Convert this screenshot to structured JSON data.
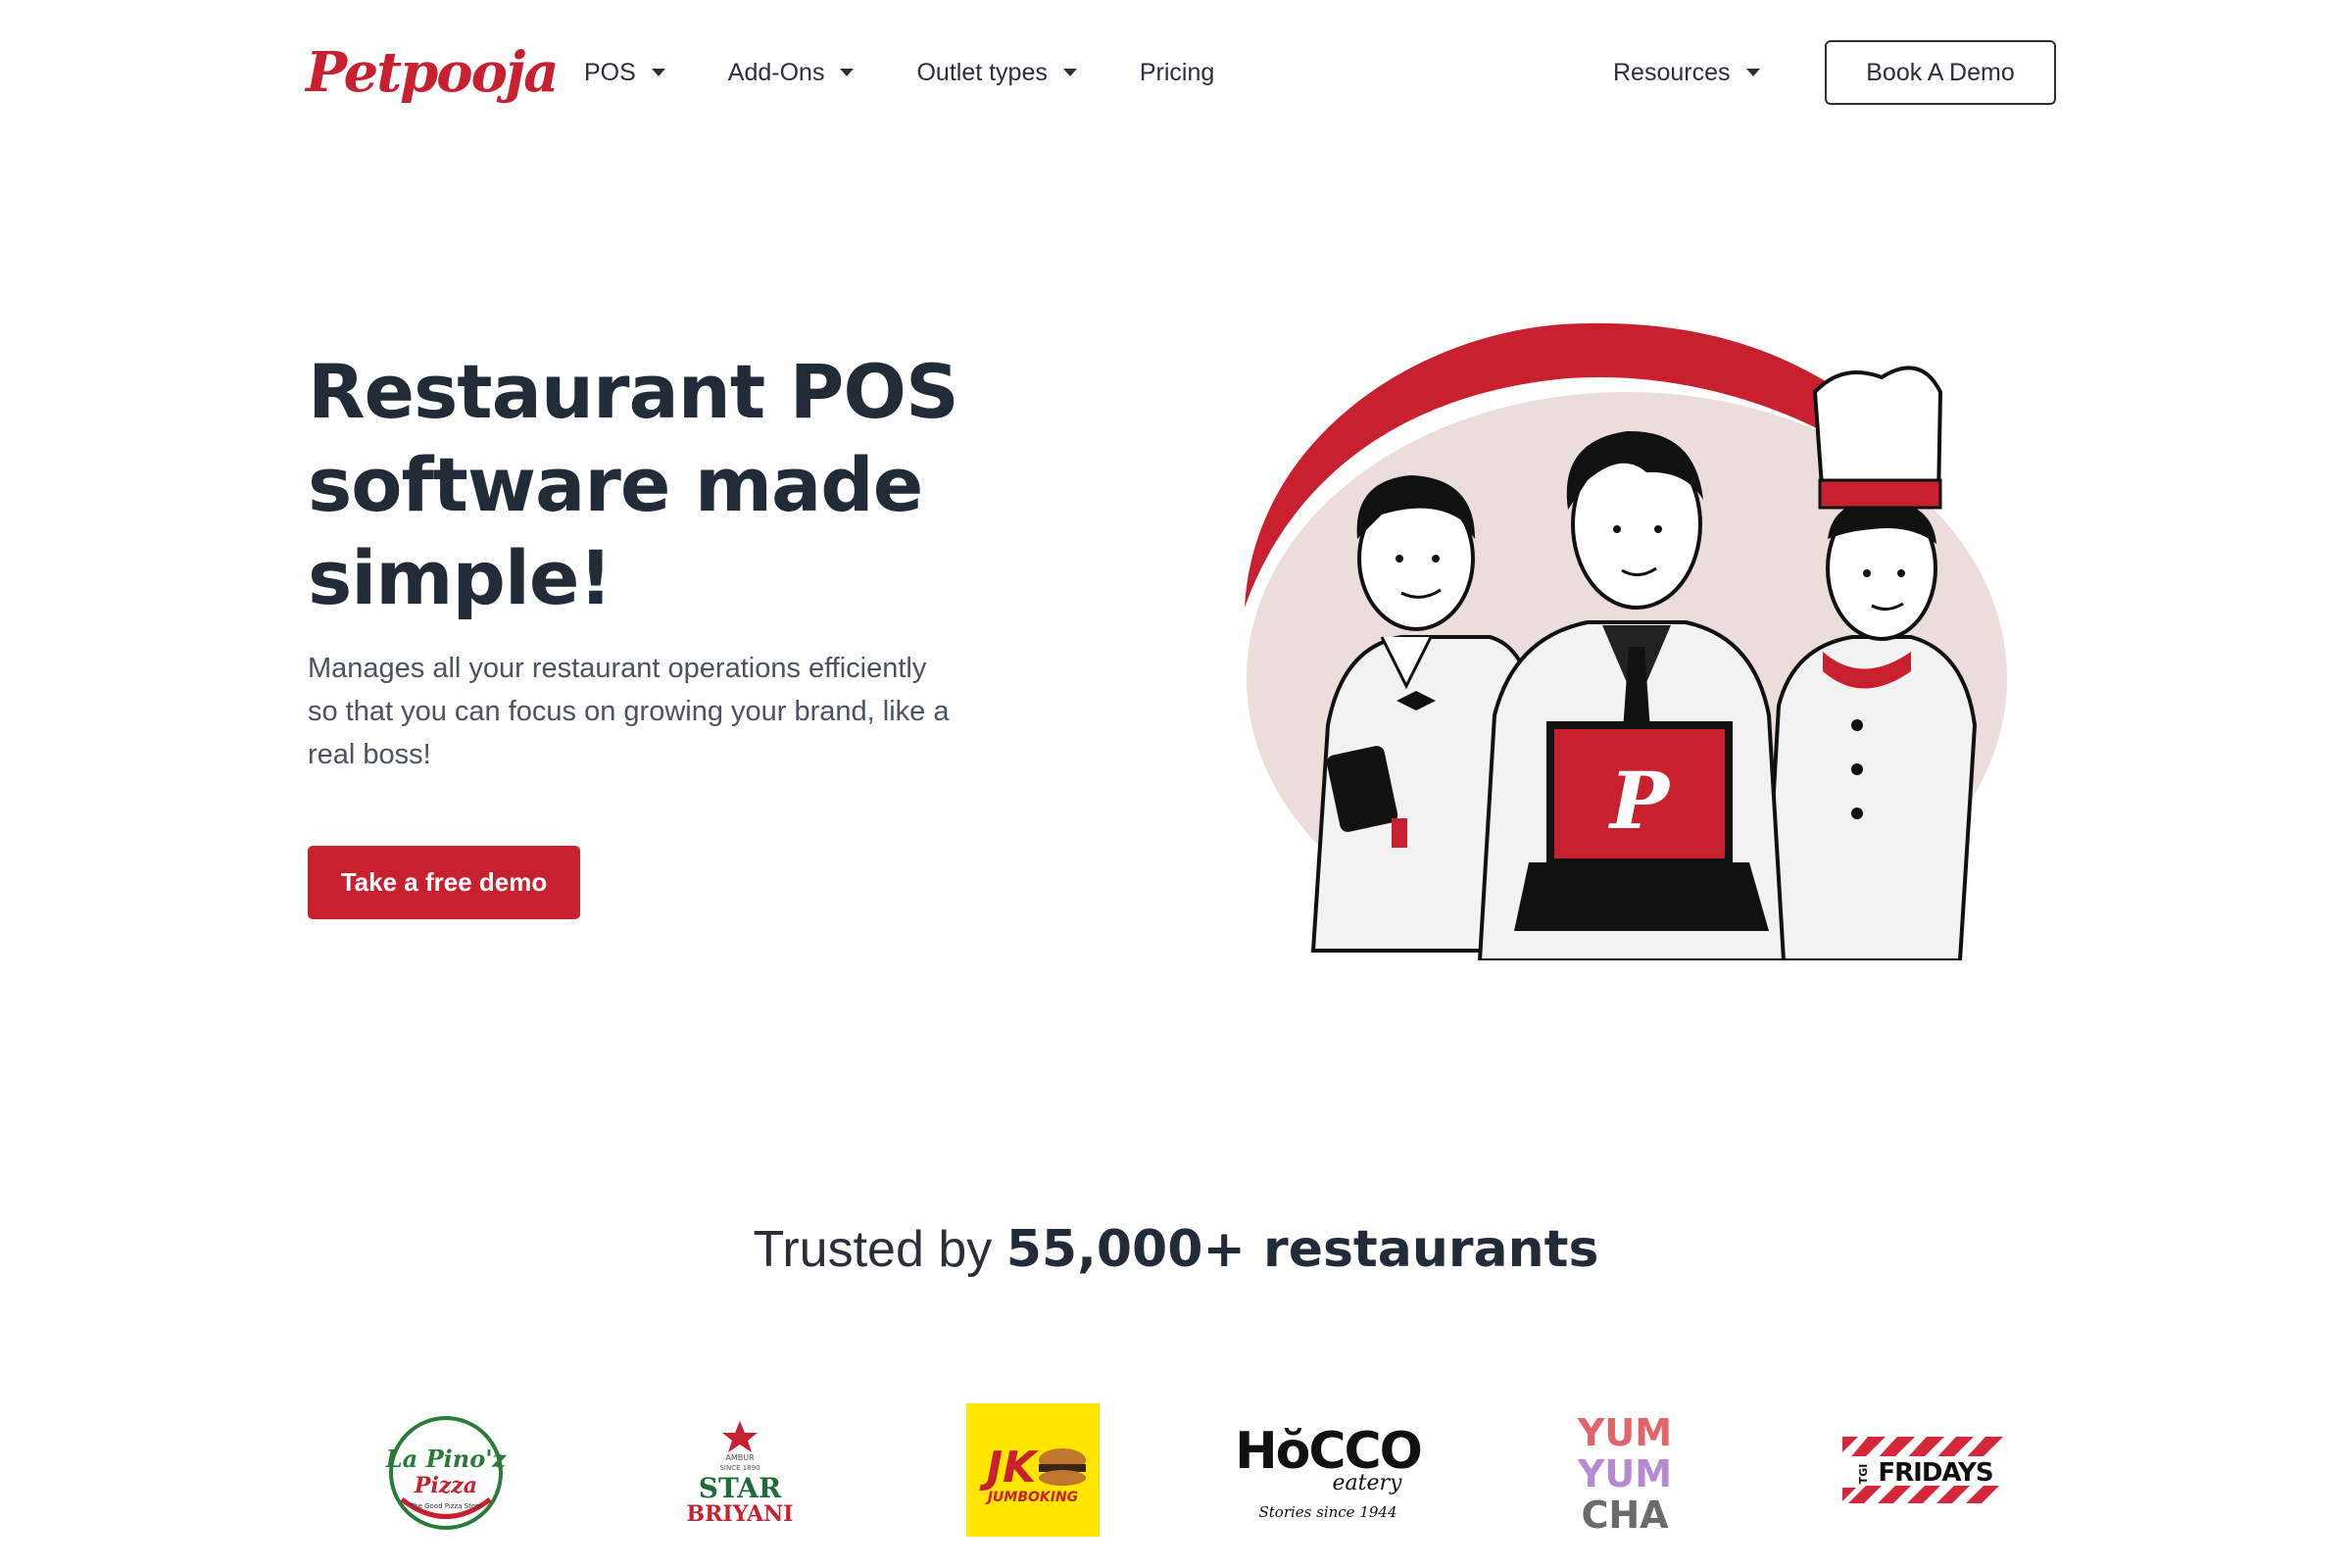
{
  "header": {
    "logo_text": "Petpooja",
    "nav": [
      {
        "label": "POS",
        "has_dropdown": true
      },
      {
        "label": "Add-Ons",
        "has_dropdown": true
      },
      {
        "label": "Outlet types",
        "has_dropdown": true
      },
      {
        "label": "Pricing",
        "has_dropdown": false
      }
    ],
    "resources_label": "Resources",
    "book_demo_label": "Book A Demo"
  },
  "hero": {
    "title": "Restaurant POS software made simple!",
    "subtitle": "Manages all your restaurant operations efficiently so that you can focus on growing your brand, like a real boss!",
    "cta_label": "Take a free demo",
    "laptop_letter": "P"
  },
  "trusted": {
    "prefix": "Trusted by",
    "highlight": "55,000+ restaurants"
  },
  "brands": [
    {
      "name": "La Pino'z Pizza",
      "line1": "La Pino'z",
      "line2": "Pizza",
      "tagline": "The Good Pizza Store"
    },
    {
      "name": "Star Briyani",
      "line0": "AMBUR",
      "line0b": "SINCE 1890",
      "line1": "STAR",
      "line2": "BRIYANI"
    },
    {
      "name": "Jumboking",
      "line1": "JK",
      "line2": "JUMBOKING"
    },
    {
      "name": "Hocco eatery",
      "line1": "HŏCCO",
      "line2": "eatery",
      "line3": "Stories since 1944"
    },
    {
      "name": "Yum Yum Cha",
      "line1": "YUM",
      "line2": "YUM",
      "line3": "CHA"
    },
    {
      "name": "TGI Fridays",
      "line0": "TGI",
      "line1": "FRIDAYS"
    }
  ],
  "colors": {
    "brand_red": "#c8202f",
    "text_dark": "#222b38",
    "blob_pink": "#ecdcdc",
    "jumboking_yellow": "#ffe600"
  }
}
